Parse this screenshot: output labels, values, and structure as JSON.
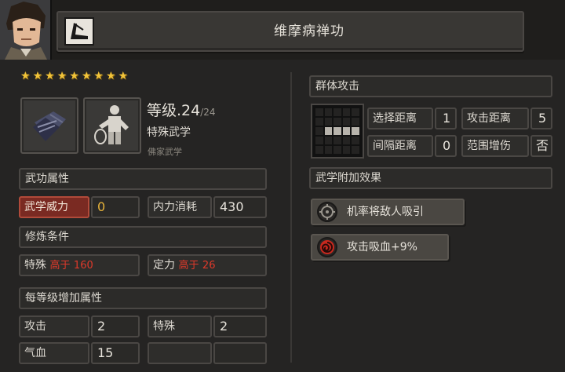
{
  "header": {
    "title": "维摩病禅功"
  },
  "stars": {
    "count": 9,
    "glyph": "★"
  },
  "info": {
    "level_prefix": "等级.",
    "level": "24",
    "level_max": "/24",
    "type": "特殊武学",
    "school": "佛家武学"
  },
  "attributes": {
    "section_title": "武功属性",
    "power_label": "武学威力",
    "power_value": "0",
    "cost_label": "内力消耗",
    "cost_value": "430"
  },
  "requirements": {
    "section_title": "修炼条件",
    "items": [
      {
        "label": "特殊",
        "cond": "高于",
        "value": "160"
      },
      {
        "label": "定力",
        "cond": "高于",
        "value": "26"
      }
    ]
  },
  "per_level": {
    "section_title": "每等级增加属性",
    "items": [
      {
        "label": "攻击",
        "value": "2"
      },
      {
        "label": "特殊",
        "value": "2"
      },
      {
        "label": "气血",
        "value": "15"
      },
      {
        "label": "",
        "value": ""
      }
    ]
  },
  "attack": {
    "section_title": "群体攻击",
    "select_range_label": "选择距离",
    "select_range_value": "1",
    "attack_range_label": "攻击距离",
    "attack_range_value": "5",
    "gap_range_label": "间隔距离",
    "gap_range_value": "0",
    "area_bonus_label": "范围增伤",
    "area_bonus_value": "否"
  },
  "effects": {
    "section_title": "武学附加效果",
    "items": [
      {
        "text": "机率将敌人吸引",
        "icon": "target-icon"
      },
      {
        "text": "攻击吸血+9%",
        "icon": "swirl-icon"
      }
    ]
  },
  "colors": {
    "gold": "#e6b23a",
    "red": "#e0392a",
    "active": "#7a2a22"
  }
}
